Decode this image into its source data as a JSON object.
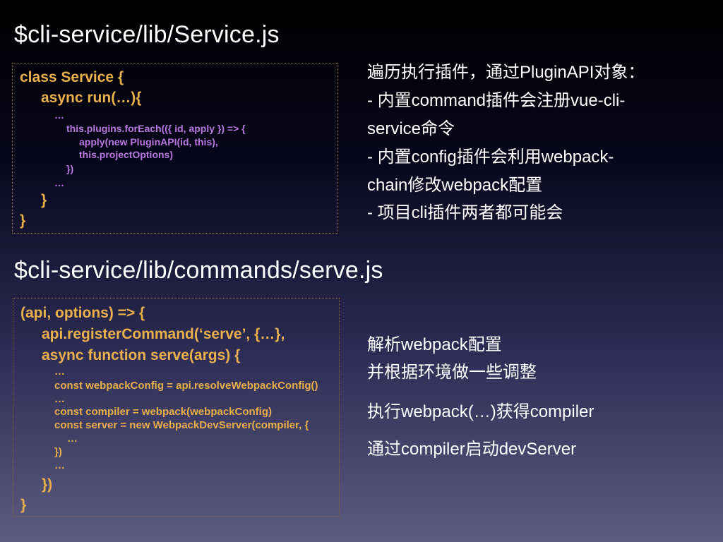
{
  "slide": {
    "section1": {
      "title": "$cli-service/lib/Service.js",
      "code": [
        "class Service {",
        "async run(…){",
        "…",
        "this.plugins.forEach(({ id, apply }) => {",
        "apply(new PluginAPI(id, this),",
        "this.projectOptions)",
        "})",
        "…",
        "}",
        "}"
      ],
      "description": [
        "遍历执行插件，通过PluginAPI对象：",
        "- 内置command插件会注册vue-cli-",
        "service命令",
        "- 内置config插件会利用webpack-",
        "chain修改webpack配置",
        "- 项目cli插件两者都可能会"
      ]
    },
    "section2": {
      "title": "$cli-service/lib/commands/serve.js",
      "code": [
        "(api, options) => {",
        "api.registerCommand(‘serve’,  {…},",
        "async function serve(args) {",
        "…",
        "const webpackConfig = api.resolveWebpackConfig()",
        "…",
        "const compiler = webpack(webpackConfig)",
        "const server = new WebpackDevServer(compiler, {",
        "…",
        "})",
        "…",
        "})",
        "}"
      ],
      "description": [
        "解析webpack配置",
        "并根据环境做一些调整",
        "执行webpack(…)获得compiler",
        "通过compiler启动devServer"
      ]
    },
    "colors": {
      "code_orange": "#eab04b",
      "code_purple": "#b878e0",
      "box_border": "#8a6a32",
      "text": "#ffffff"
    }
  }
}
